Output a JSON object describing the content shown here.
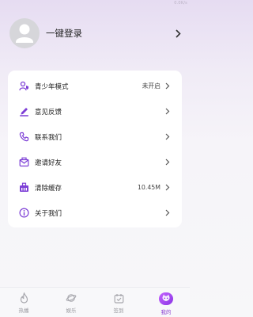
{
  "status": {
    "badge": "0.0K/s"
  },
  "profile": {
    "login_label": "一键登录"
  },
  "menu": {
    "items": [
      {
        "label": "青少年模式",
        "value": "未开启",
        "icon": "user-shield-icon"
      },
      {
        "label": "意见反馈",
        "value": "",
        "icon": "pen-feedback-icon"
      },
      {
        "label": "联系我们",
        "value": "",
        "icon": "phone-icon"
      },
      {
        "label": "邀请好友",
        "value": "",
        "icon": "envelope-icon"
      },
      {
        "label": "清除缓存",
        "value": "10.45M",
        "icon": "cache-icon"
      },
      {
        "label": "关于我们",
        "value": "",
        "icon": "info-icon"
      }
    ]
  },
  "tabbar": {
    "tabs": [
      {
        "label": "热播",
        "icon": "flame-icon",
        "active": false
      },
      {
        "label": "娱乐",
        "icon": "planet-icon",
        "active": false
      },
      {
        "label": "签到",
        "icon": "calendar-icon",
        "active": false
      },
      {
        "label": "我的",
        "icon": "cat-face-icon",
        "active": true
      }
    ]
  },
  "colors": {
    "accent": "#8a36e4",
    "icon_purple": "#7d3fd6",
    "background_top": "#e6dcf2"
  }
}
